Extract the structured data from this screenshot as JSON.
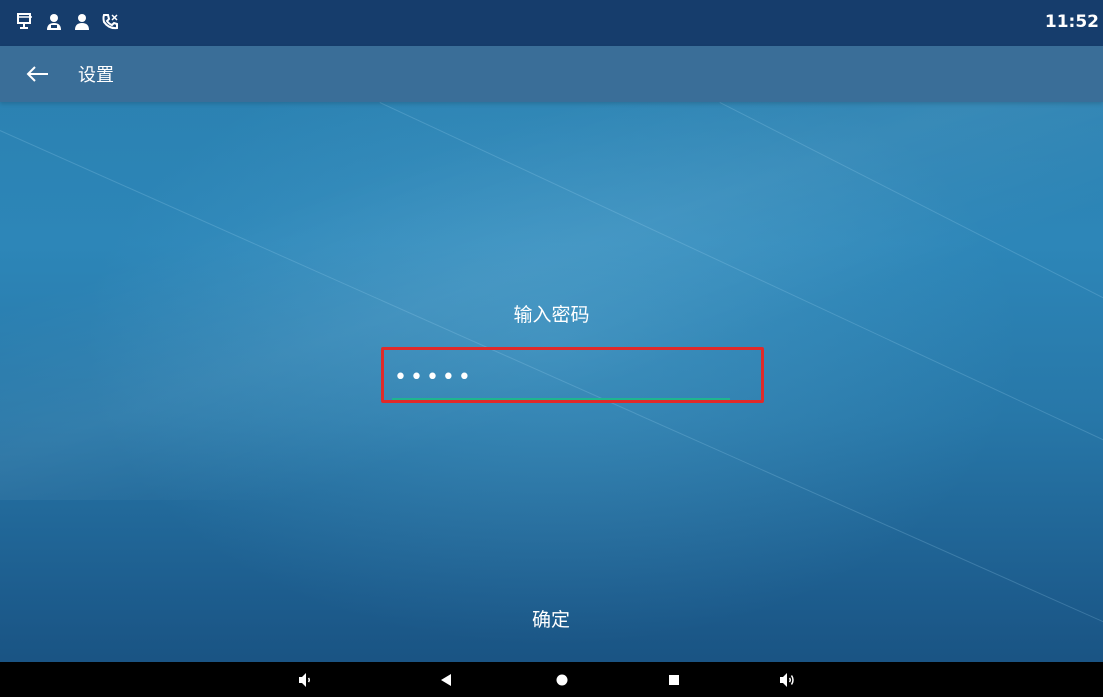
{
  "status_bar": {
    "time": "11:52",
    "icons": [
      "network-icon",
      "contact-icon",
      "contact-icon",
      "missed-call-icon"
    ]
  },
  "title_bar": {
    "back_icon": "arrow-left-icon",
    "title": "设置"
  },
  "password_prompt": {
    "label": "输入密码",
    "value_masked": "•••••",
    "highlight_color": "#e02a2a",
    "underline_color": "#1fb58e"
  },
  "confirm_button": {
    "label": "确定"
  },
  "nav_bar": {
    "buttons": [
      "volume-down-icon",
      "back-triangle-icon",
      "home-circle-icon",
      "recents-square-icon",
      "volume-up-icon"
    ]
  },
  "colors": {
    "status_bar": "#163d6c",
    "title_bar": "#3a6e98",
    "accent": "#1fb58e"
  }
}
